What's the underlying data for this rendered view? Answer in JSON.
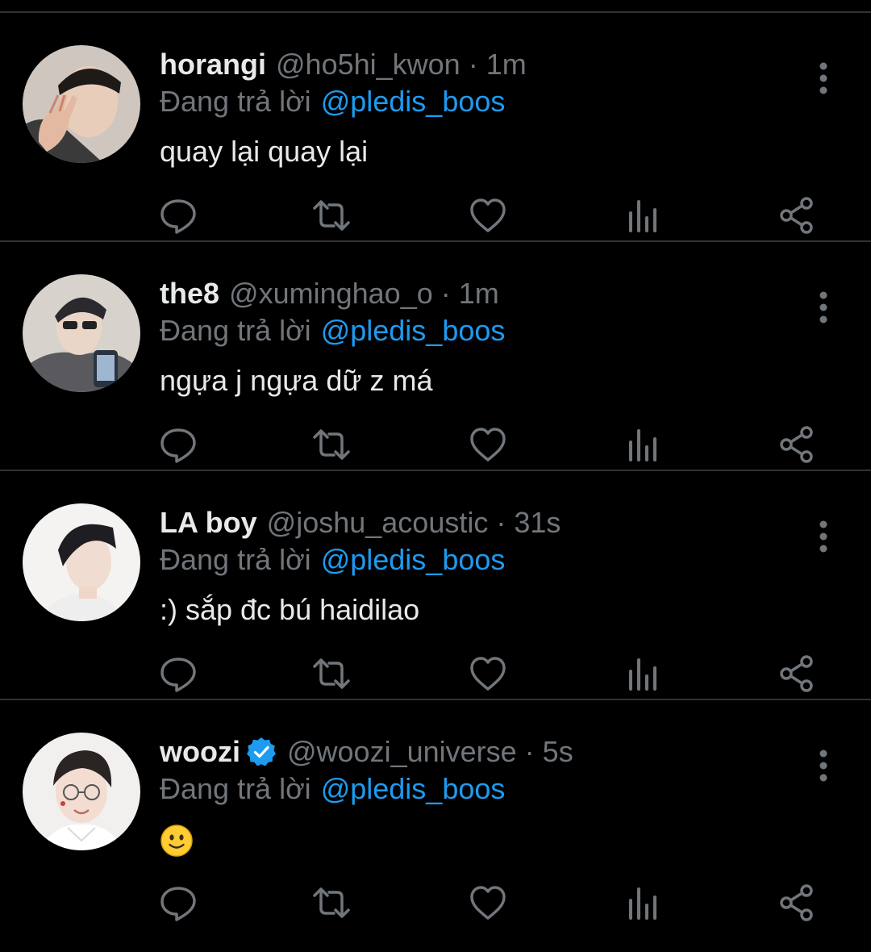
{
  "colors": {
    "background": "#000000",
    "text": "#e7e9ea",
    "muted": "#71767b",
    "accent": "#1d9bf0",
    "divider": "#2f3336"
  },
  "tweets": [
    {
      "display_name": "horangi",
      "handle": "@ho5hi_kwon",
      "separator": "·",
      "time": "1m",
      "verified": false,
      "reply_prefix": "Đang trả lời",
      "reply_to": "@pledis_boos",
      "text": "quay lại quay lại"
    },
    {
      "display_name": "the8",
      "handle": "@xuminghao_o",
      "separator": "·",
      "time": "1m",
      "verified": false,
      "reply_prefix": "Đang trả lời",
      "reply_to": "@pledis_boos",
      "text": "ngựa j ngựa dữ z má"
    },
    {
      "display_name": "LA boy",
      "handle": "@joshu_acoustic",
      "separator": "·",
      "time": "31s",
      "verified": false,
      "reply_prefix": "Đang trả lời",
      "reply_to": "@pledis_boos",
      "text": ":) sắp đc bú haidilao"
    },
    {
      "display_name": "woozi",
      "handle": "@woozi_universe",
      "separator": "·",
      "time": "5s",
      "verified": true,
      "reply_prefix": "Đang trả lời",
      "reply_to": "@pledis_boos",
      "text": "",
      "emoji": "slightly-smiling-face-icon"
    }
  ],
  "action_icons": [
    "reply-icon",
    "retweet-icon",
    "like-icon",
    "views-icon",
    "share-icon"
  ],
  "more_icon": "more-vertical-icon"
}
